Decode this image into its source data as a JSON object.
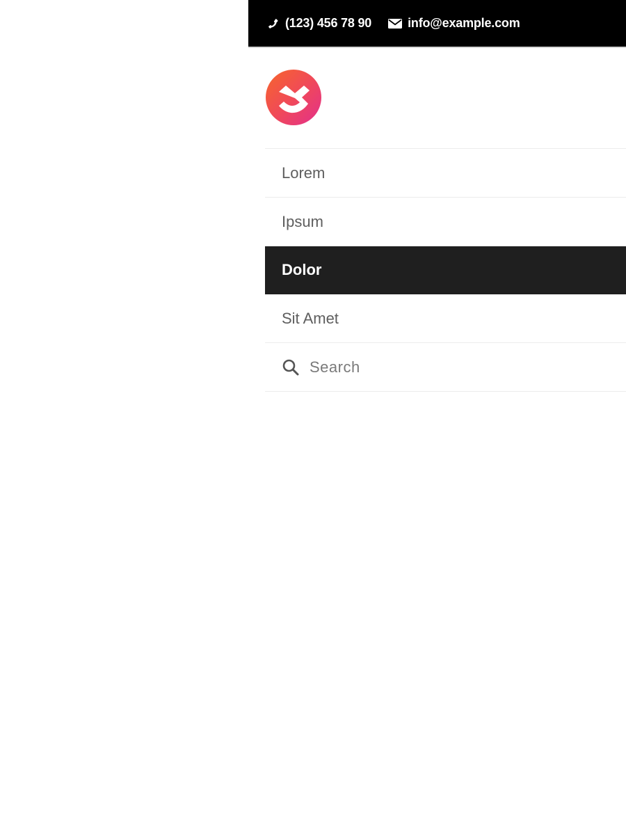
{
  "topbar": {
    "phone": "(123) 456 78 90",
    "email": "info@example.com",
    "phone_icon": "phone-icon",
    "email_icon": "envelope-icon"
  },
  "logo": {
    "icon": "brand-logo",
    "gradient": [
      "#f7662b",
      "#f04a58",
      "#e32f8c"
    ]
  },
  "menu": {
    "items": [
      {
        "label": "Lorem",
        "active": false
      },
      {
        "label": "Ipsum",
        "active": false
      },
      {
        "label": "Dolor",
        "active": true
      },
      {
        "label": "Sit Amet",
        "active": false
      }
    ],
    "search_label": "Search",
    "search_icon": "search-icon"
  },
  "colors": {
    "topbar_bg": "#000000",
    "active_item_bg": "#1f1f1f",
    "item_text": "#5e5e5e",
    "divider": "#ececec"
  }
}
